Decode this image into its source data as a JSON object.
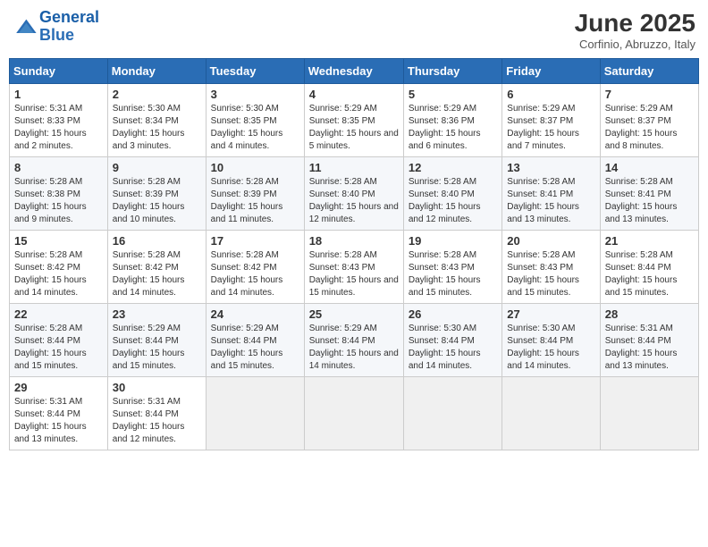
{
  "header": {
    "logo_text_general": "General",
    "logo_text_blue": "Blue",
    "month_title": "June 2025",
    "subtitle": "Corfinio, Abruzzo, Italy"
  },
  "weekdays": [
    "Sunday",
    "Monday",
    "Tuesday",
    "Wednesday",
    "Thursday",
    "Friday",
    "Saturday"
  ],
  "weeks": [
    [
      {
        "day": "1",
        "sunrise": "Sunrise: 5:31 AM",
        "sunset": "Sunset: 8:33 PM",
        "daylight": "Daylight: 15 hours and 2 minutes."
      },
      {
        "day": "2",
        "sunrise": "Sunrise: 5:30 AM",
        "sunset": "Sunset: 8:34 PM",
        "daylight": "Daylight: 15 hours and 3 minutes."
      },
      {
        "day": "3",
        "sunrise": "Sunrise: 5:30 AM",
        "sunset": "Sunset: 8:35 PM",
        "daylight": "Daylight: 15 hours and 4 minutes."
      },
      {
        "day": "4",
        "sunrise": "Sunrise: 5:29 AM",
        "sunset": "Sunset: 8:35 PM",
        "daylight": "Daylight: 15 hours and 5 minutes."
      },
      {
        "day": "5",
        "sunrise": "Sunrise: 5:29 AM",
        "sunset": "Sunset: 8:36 PM",
        "daylight": "Daylight: 15 hours and 6 minutes."
      },
      {
        "day": "6",
        "sunrise": "Sunrise: 5:29 AM",
        "sunset": "Sunset: 8:37 PM",
        "daylight": "Daylight: 15 hours and 7 minutes."
      },
      {
        "day": "7",
        "sunrise": "Sunrise: 5:29 AM",
        "sunset": "Sunset: 8:37 PM",
        "daylight": "Daylight: 15 hours and 8 minutes."
      }
    ],
    [
      {
        "day": "8",
        "sunrise": "Sunrise: 5:28 AM",
        "sunset": "Sunset: 8:38 PM",
        "daylight": "Daylight: 15 hours and 9 minutes."
      },
      {
        "day": "9",
        "sunrise": "Sunrise: 5:28 AM",
        "sunset": "Sunset: 8:39 PM",
        "daylight": "Daylight: 15 hours and 10 minutes."
      },
      {
        "day": "10",
        "sunrise": "Sunrise: 5:28 AM",
        "sunset": "Sunset: 8:39 PM",
        "daylight": "Daylight: 15 hours and 11 minutes."
      },
      {
        "day": "11",
        "sunrise": "Sunrise: 5:28 AM",
        "sunset": "Sunset: 8:40 PM",
        "daylight": "Daylight: 15 hours and 12 minutes."
      },
      {
        "day": "12",
        "sunrise": "Sunrise: 5:28 AM",
        "sunset": "Sunset: 8:40 PM",
        "daylight": "Daylight: 15 hours and 12 minutes."
      },
      {
        "day": "13",
        "sunrise": "Sunrise: 5:28 AM",
        "sunset": "Sunset: 8:41 PM",
        "daylight": "Daylight: 15 hours and 13 minutes."
      },
      {
        "day": "14",
        "sunrise": "Sunrise: 5:28 AM",
        "sunset": "Sunset: 8:41 PM",
        "daylight": "Daylight: 15 hours and 13 minutes."
      }
    ],
    [
      {
        "day": "15",
        "sunrise": "Sunrise: 5:28 AM",
        "sunset": "Sunset: 8:42 PM",
        "daylight": "Daylight: 15 hours and 14 minutes."
      },
      {
        "day": "16",
        "sunrise": "Sunrise: 5:28 AM",
        "sunset": "Sunset: 8:42 PM",
        "daylight": "Daylight: 15 hours and 14 minutes."
      },
      {
        "day": "17",
        "sunrise": "Sunrise: 5:28 AM",
        "sunset": "Sunset: 8:42 PM",
        "daylight": "Daylight: 15 hours and 14 minutes."
      },
      {
        "day": "18",
        "sunrise": "Sunrise: 5:28 AM",
        "sunset": "Sunset: 8:43 PM",
        "daylight": "Daylight: 15 hours and 15 minutes."
      },
      {
        "day": "19",
        "sunrise": "Sunrise: 5:28 AM",
        "sunset": "Sunset: 8:43 PM",
        "daylight": "Daylight: 15 hours and 15 minutes."
      },
      {
        "day": "20",
        "sunrise": "Sunrise: 5:28 AM",
        "sunset": "Sunset: 8:43 PM",
        "daylight": "Daylight: 15 hours and 15 minutes."
      },
      {
        "day": "21",
        "sunrise": "Sunrise: 5:28 AM",
        "sunset": "Sunset: 8:44 PM",
        "daylight": "Daylight: 15 hours and 15 minutes."
      }
    ],
    [
      {
        "day": "22",
        "sunrise": "Sunrise: 5:28 AM",
        "sunset": "Sunset: 8:44 PM",
        "daylight": "Daylight: 15 hours and 15 minutes."
      },
      {
        "day": "23",
        "sunrise": "Sunrise: 5:29 AM",
        "sunset": "Sunset: 8:44 PM",
        "daylight": "Daylight: 15 hours and 15 minutes."
      },
      {
        "day": "24",
        "sunrise": "Sunrise: 5:29 AM",
        "sunset": "Sunset: 8:44 PM",
        "daylight": "Daylight: 15 hours and 15 minutes."
      },
      {
        "day": "25",
        "sunrise": "Sunrise: 5:29 AM",
        "sunset": "Sunset: 8:44 PM",
        "daylight": "Daylight: 15 hours and 14 minutes."
      },
      {
        "day": "26",
        "sunrise": "Sunrise: 5:30 AM",
        "sunset": "Sunset: 8:44 PM",
        "daylight": "Daylight: 15 hours and 14 minutes."
      },
      {
        "day": "27",
        "sunrise": "Sunrise: 5:30 AM",
        "sunset": "Sunset: 8:44 PM",
        "daylight": "Daylight: 15 hours and 14 minutes."
      },
      {
        "day": "28",
        "sunrise": "Sunrise: 5:31 AM",
        "sunset": "Sunset: 8:44 PM",
        "daylight": "Daylight: 15 hours and 13 minutes."
      }
    ],
    [
      {
        "day": "29",
        "sunrise": "Sunrise: 5:31 AM",
        "sunset": "Sunset: 8:44 PM",
        "daylight": "Daylight: 15 hours and 13 minutes."
      },
      {
        "day": "30",
        "sunrise": "Sunrise: 5:31 AM",
        "sunset": "Sunset: 8:44 PM",
        "daylight": "Daylight: 15 hours and 12 minutes."
      },
      null,
      null,
      null,
      null,
      null
    ]
  ]
}
